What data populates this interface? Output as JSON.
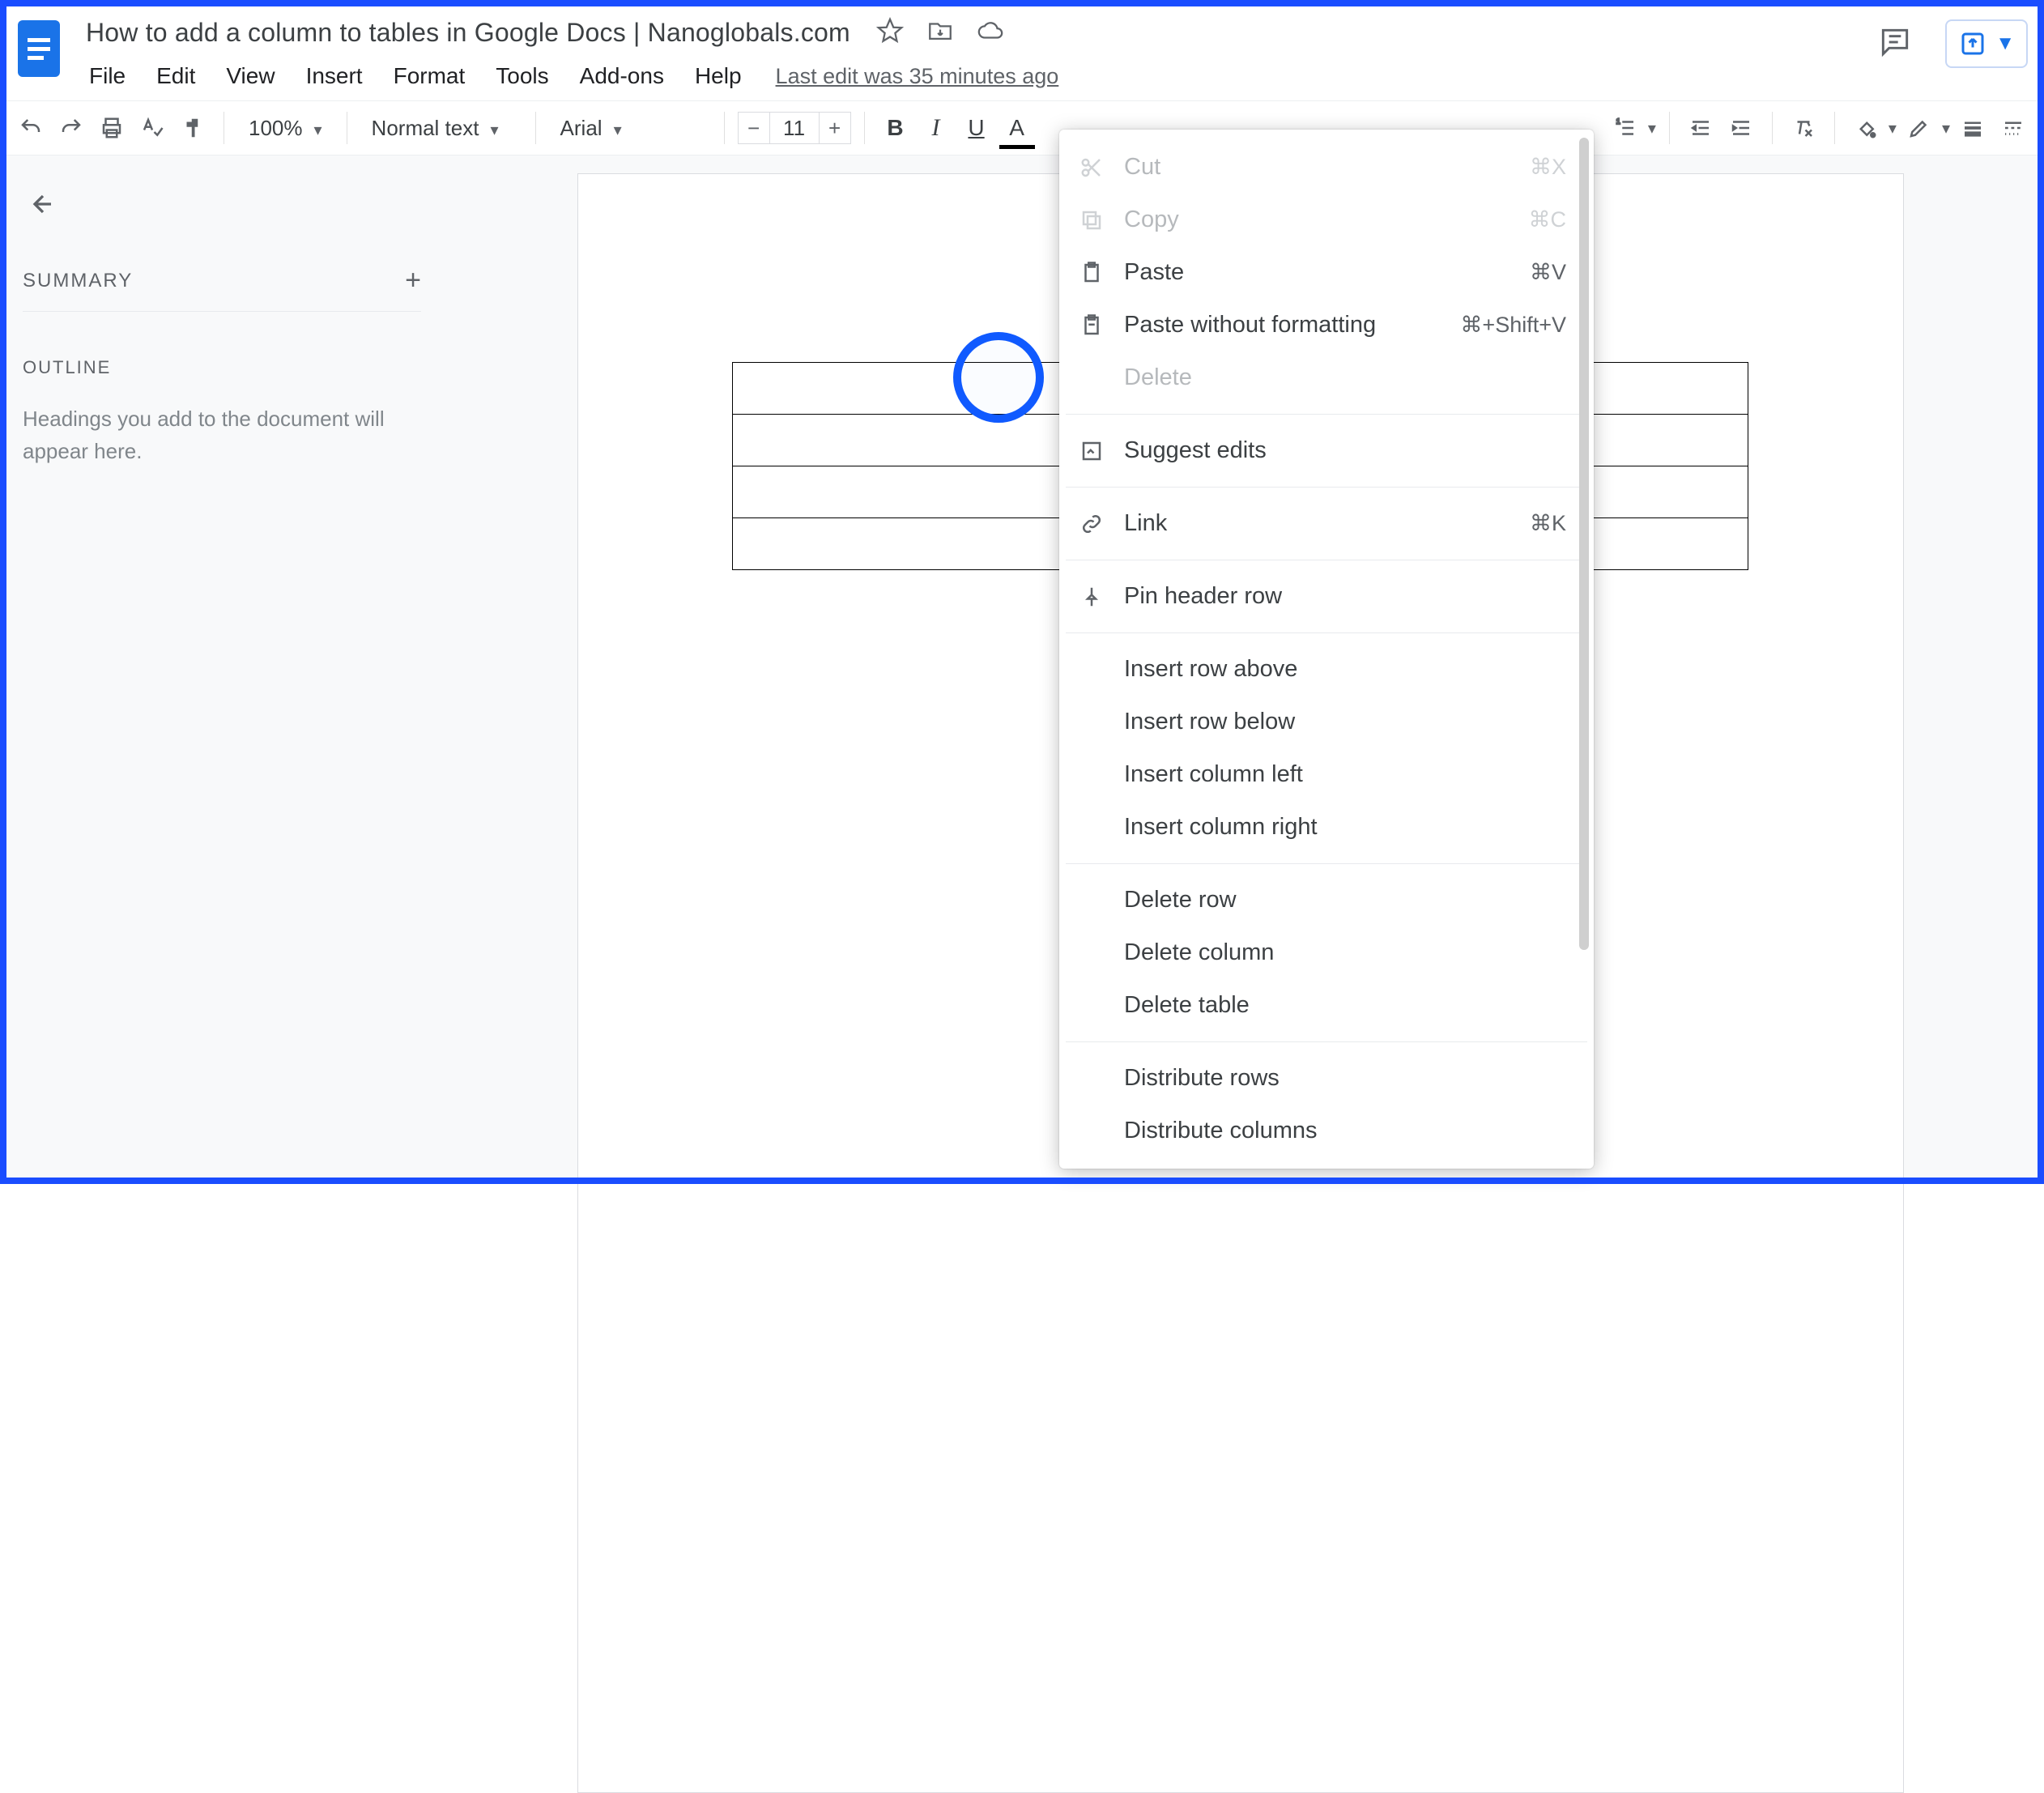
{
  "header": {
    "doc_title": "How to add a column to tables in Google Docs | Nanoglobals.com",
    "last_edit": "Last edit was 35 minutes ago"
  },
  "menubar": [
    "File",
    "Edit",
    "View",
    "Insert",
    "Format",
    "Tools",
    "Add-ons",
    "Help"
  ],
  "toolbar": {
    "zoom": "100%",
    "style": "Normal text",
    "font": "Arial",
    "font_size": "11"
  },
  "sidebar": {
    "summary_label": "SUMMARY",
    "outline_label": "OUTLINE",
    "outline_hint": "Headings you add to the document will appear here."
  },
  "context_menu": {
    "cut": {
      "label": "Cut",
      "shortcut": "⌘X"
    },
    "copy": {
      "label": "Copy",
      "shortcut": "⌘C"
    },
    "paste": {
      "label": "Paste",
      "shortcut": "⌘V"
    },
    "paste_nf": {
      "label": "Paste without formatting",
      "shortcut": "⌘+Shift+V"
    },
    "delete": {
      "label": "Delete"
    },
    "suggest": {
      "label": "Suggest edits"
    },
    "link": {
      "label": "Link",
      "shortcut": "⌘K"
    },
    "pin": {
      "label": "Pin header row"
    },
    "insert_row_above": {
      "label": "Insert row above"
    },
    "insert_row_below": {
      "label": "Insert row below"
    },
    "insert_col_left": {
      "label": "Insert column left"
    },
    "insert_col_right": {
      "label": "Insert column right"
    },
    "delete_row": {
      "label": "Delete row"
    },
    "delete_col": {
      "label": "Delete column"
    },
    "delete_table": {
      "label": "Delete table"
    },
    "dist_rows": {
      "label": "Distribute rows"
    },
    "dist_cols": {
      "label": "Distribute columns"
    }
  }
}
